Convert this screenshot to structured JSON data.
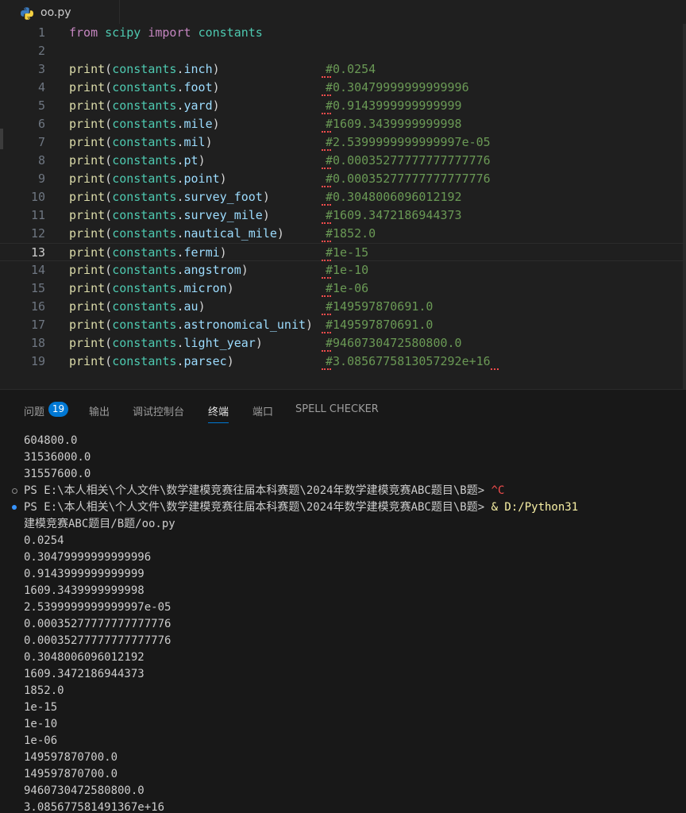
{
  "tab": {
    "filename": "oo.py"
  },
  "editor": {
    "current_line": 13,
    "lines": [
      {
        "n": "1",
        "type": "import",
        "kw1": "from",
        "mod": "scipy",
        "kw2": "import",
        "name": "constants"
      },
      {
        "n": "2",
        "type": "blank"
      },
      {
        "n": "3",
        "type": "print",
        "attr": "inch",
        "comment": "#0.0254"
      },
      {
        "n": "4",
        "type": "print",
        "attr": "foot",
        "comment": "#0.30479999999999996"
      },
      {
        "n": "5",
        "type": "print",
        "attr": "yard",
        "comment": "#0.9143999999999999"
      },
      {
        "n": "6",
        "type": "print",
        "attr": "mile",
        "comment": "#1609.3439999999998"
      },
      {
        "n": "7",
        "type": "print",
        "attr": "mil",
        "comment": "#2.5399999999999997e-05"
      },
      {
        "n": "8",
        "type": "print",
        "attr": "pt",
        "comment": "#0.00035277777777777776"
      },
      {
        "n": "9",
        "type": "print",
        "attr": "point",
        "comment": "#0.00035277777777777776"
      },
      {
        "n": "10",
        "type": "print",
        "attr": "survey_foot",
        "comment": "#0.3048006096012192"
      },
      {
        "n": "11",
        "type": "print",
        "attr": "survey_mile",
        "comment": "#1609.3472186944373"
      },
      {
        "n": "12",
        "type": "print",
        "attr": "nautical_mile",
        "comment": "#1852.0"
      },
      {
        "n": "13",
        "type": "print",
        "attr": "fermi",
        "comment": "#1e-15"
      },
      {
        "n": "14",
        "type": "print",
        "attr": "angstrom",
        "comment": "#1e-10"
      },
      {
        "n": "15",
        "type": "print",
        "attr": "micron",
        "comment": "#1e-06"
      },
      {
        "n": "16",
        "type": "print",
        "attr": "au",
        "comment": "#149597870691.0"
      },
      {
        "n": "17",
        "type": "print",
        "attr": "astronomical_unit",
        "comment": "#149597870691.0"
      },
      {
        "n": "18",
        "type": "print",
        "attr": "light_year",
        "comment": "#9460730472580800.0"
      },
      {
        "n": "19",
        "type": "print",
        "attr": "parsec",
        "comment": "#3.0856775813057292e+16"
      }
    ],
    "print_fn": "print",
    "obj": "constants"
  },
  "panel": {
    "tabs": [
      {
        "label": "问题",
        "active": false,
        "badge": "19"
      },
      {
        "label": "输出",
        "active": false
      },
      {
        "label": "调试控制台",
        "active": false
      },
      {
        "label": "终端",
        "active": true
      },
      {
        "label": "端口",
        "active": false
      },
      {
        "label": "SPELL CHECKER",
        "active": false
      }
    ]
  },
  "terminal": {
    "lines": [
      {
        "text": "604800.0"
      },
      {
        "text": "31536000.0"
      },
      {
        "text": "31557600.0"
      },
      {
        "marker": "empty",
        "prompt": "PS E:\\本人相关\\个人文件\\数学建模竞赛往届本科赛题\\2024年数学建模竞赛ABC题目\\B题> ",
        "extra": "^C",
        "extra_class": "ctrlc"
      },
      {
        "marker": "filled",
        "prompt": "PS E:\\本人相关\\个人文件\\数学建模竞赛往届本科赛题\\2024年数学建模竞赛ABC题目\\B题> ",
        "extra": "& D:/Python31",
        "extra_class": "cmdpath"
      },
      {
        "text": "建模竞赛ABC题目/B题/oo.py"
      },
      {
        "text": "0.0254"
      },
      {
        "text": "0.30479999999999996"
      },
      {
        "text": "0.9143999999999999"
      },
      {
        "text": "1609.3439999999998"
      },
      {
        "text": "2.5399999999999997e-05"
      },
      {
        "text": "0.00035277777777777776"
      },
      {
        "text": "0.00035277777777777776"
      },
      {
        "text": "0.3048006096012192"
      },
      {
        "text": "1609.3472186944373"
      },
      {
        "text": "1852.0"
      },
      {
        "text": "1e-15"
      },
      {
        "text": "1e-10"
      },
      {
        "text": "1e-06"
      },
      {
        "text": "149597870700.0"
      },
      {
        "text": "149597870700.0"
      },
      {
        "text": "9460730472580800.0"
      },
      {
        "text": "3.085677581491367e+16"
      }
    ]
  }
}
